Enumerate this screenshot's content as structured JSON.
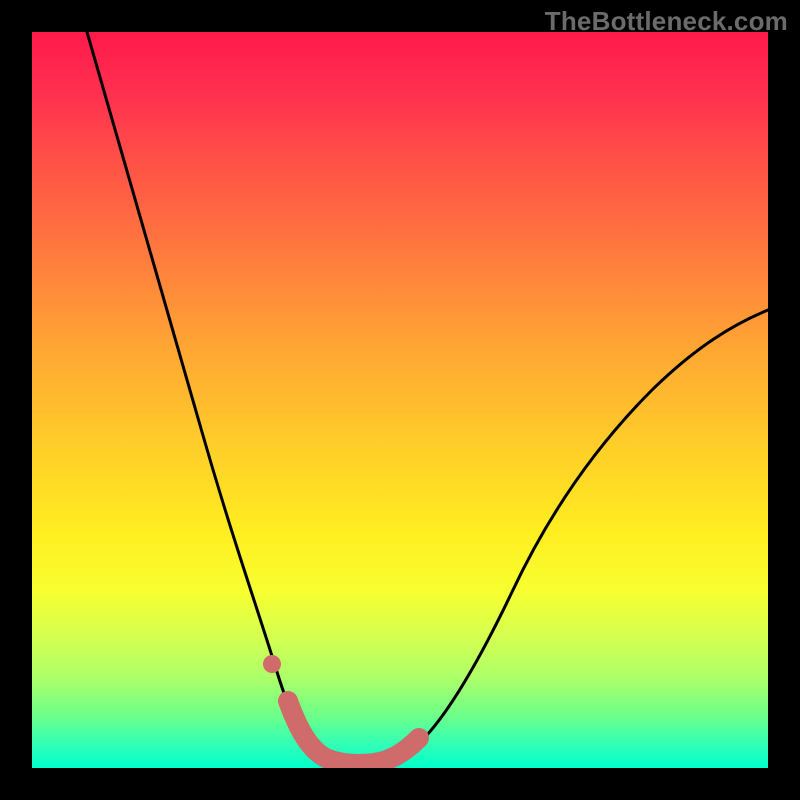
{
  "watermark": "TheBottleneck.com",
  "chart_data": {
    "type": "line",
    "title": "",
    "xlabel": "",
    "ylabel": "",
    "xlim": [
      0,
      100
    ],
    "ylim": [
      0,
      100
    ],
    "series": [
      {
        "name": "bottleneck-curve",
        "x": [
          7,
          10,
          13,
          16,
          19,
          22,
          25,
          27,
          29,
          31,
          33,
          35,
          37,
          39,
          41,
          43,
          45,
          48,
          52,
          56,
          60,
          65,
          70,
          75,
          80,
          85,
          90,
          95,
          100
        ],
        "y": [
          100,
          92,
          84,
          76,
          68,
          60,
          52,
          45,
          39,
          33,
          27,
          21,
          16,
          11,
          7,
          4,
          2,
          1,
          2,
          5,
          10,
          17,
          25,
          33,
          40,
          47,
          53,
          58,
          62
        ]
      }
    ],
    "highlight_band": {
      "name": "optimal-zone",
      "x_range": [
        33,
        45
      ],
      "description": "Minimum region highlighted on curve"
    },
    "marker_dot": {
      "x": 32,
      "y": 18
    },
    "background": "vertical-gradient-red-to-green",
    "grid": false
  }
}
